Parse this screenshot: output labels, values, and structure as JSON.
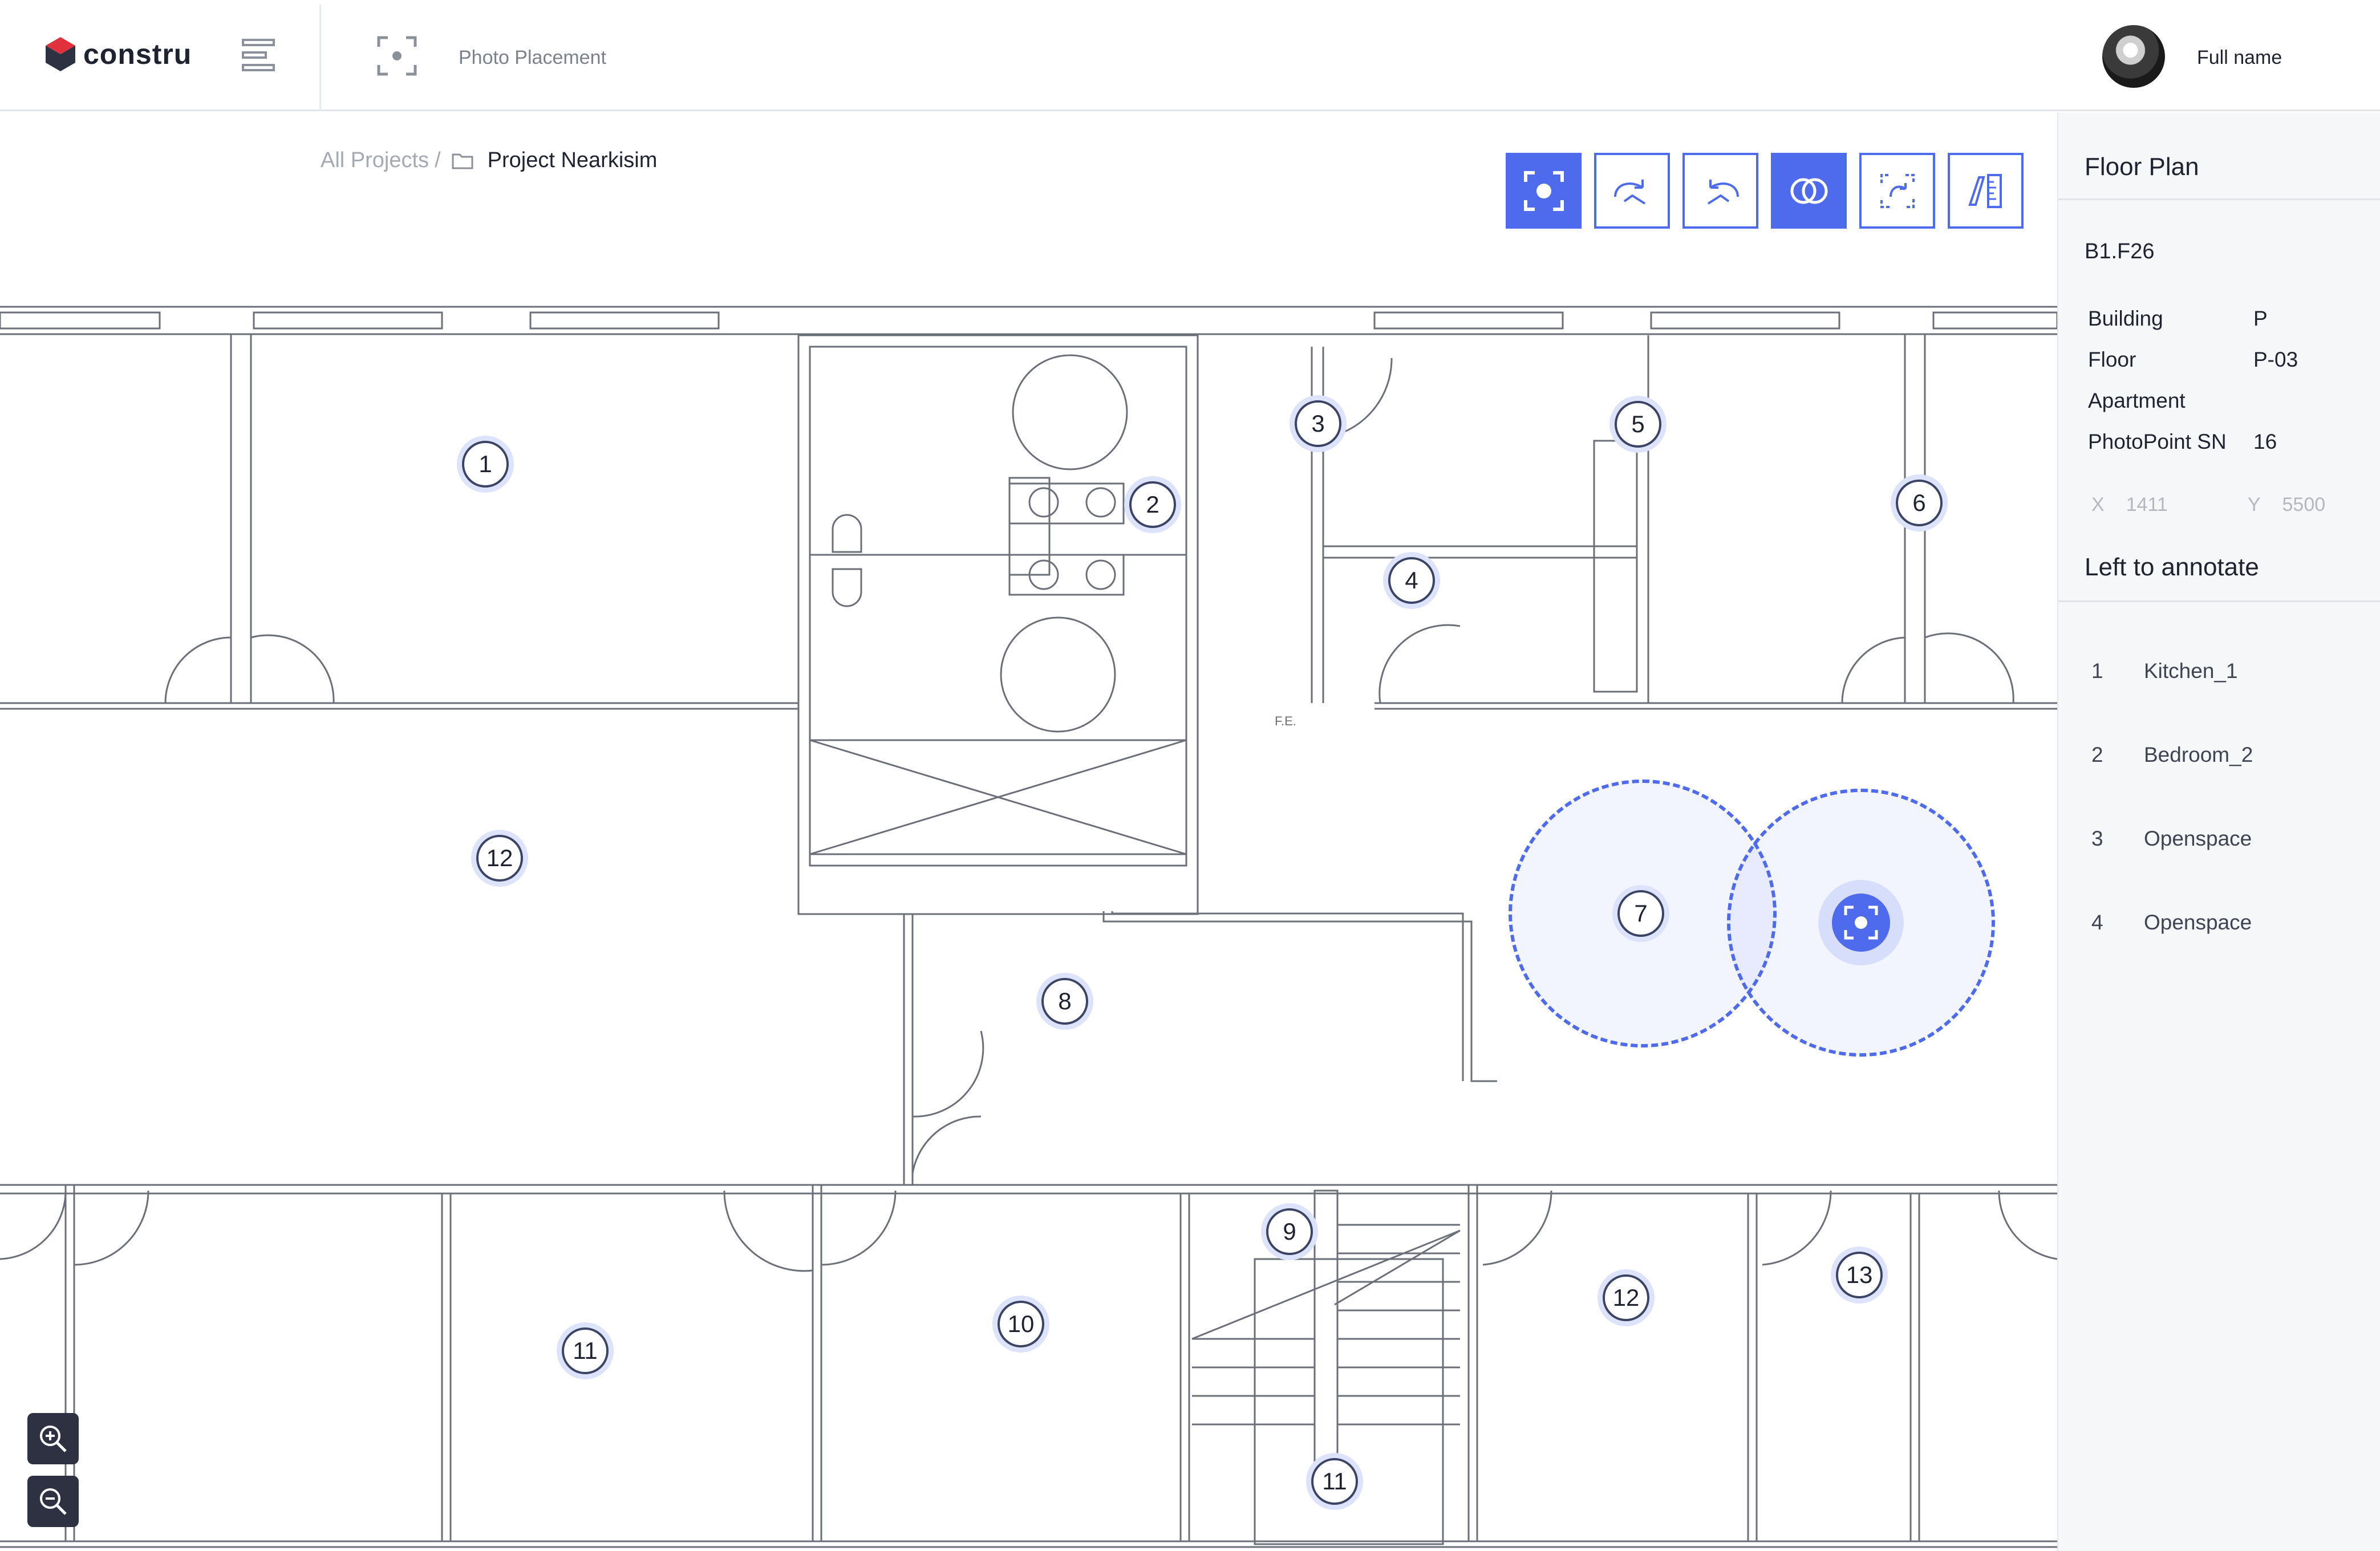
{
  "header": {
    "logo_text": "constru",
    "page_title": "Photo Placement",
    "user_name": "Full name"
  },
  "breadcrumb": {
    "root": "All Projects",
    "separator": "/",
    "current": "Project Nearkisim"
  },
  "toolbar": {
    "buttons": [
      {
        "icon": "capture-icon",
        "active": true
      },
      {
        "icon": "rotate-right-icon",
        "active": false
      },
      {
        "icon": "rotate-left-icon",
        "active": false
      },
      {
        "icon": "overlap-circles-icon",
        "active": true
      },
      {
        "icon": "replace-icon",
        "active": false
      },
      {
        "icon": "measure-icon",
        "active": false
      }
    ]
  },
  "markers": [
    {
      "label": "1"
    },
    {
      "label": "2"
    },
    {
      "label": "3"
    },
    {
      "label": "4"
    },
    {
      "label": "5"
    },
    {
      "label": "6"
    },
    {
      "label": "7"
    },
    {
      "label": "8"
    },
    {
      "label": "9"
    },
    {
      "label": "10"
    },
    {
      "label": "11"
    },
    {
      "label": "11"
    },
    {
      "label": "12"
    },
    {
      "label": "12"
    },
    {
      "label": "13"
    }
  ],
  "fe_label": "F.E.",
  "panel": {
    "title": "Floor Plan",
    "sheet_code": "B1.F26",
    "properties": [
      {
        "key": "Building",
        "value": "P"
      },
      {
        "key": "Floor",
        "value": "P-03"
      },
      {
        "key": "Apartment",
        "value": ""
      },
      {
        "key": "PhotoPoint SN",
        "value": "16"
      }
    ],
    "coords": {
      "x_label": "X",
      "x_value": "1411",
      "y_label": "Y",
      "y_value": "5500"
    },
    "annotate_title": "Left to annotate",
    "annotate_items": [
      {
        "num": "1",
        "name": "Kitchen_1"
      },
      {
        "num": "2",
        "name": "Bedroom_2"
      },
      {
        "num": "3",
        "name": "Openspace"
      },
      {
        "num": "4",
        "name": "Openspace"
      }
    ]
  },
  "colors": {
    "accent": "#4f6bed",
    "dark": "#2d3142",
    "panel_bg": "#f6f7f9",
    "muted": "#a5a9b2"
  }
}
